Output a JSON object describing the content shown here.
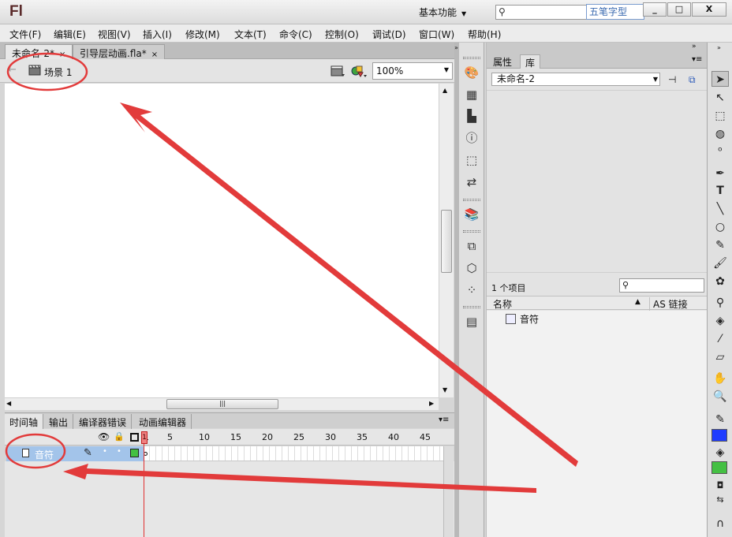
{
  "app": {
    "logo": "Fl",
    "workspace": "基本功能",
    "ime_badge": "五笔字型"
  },
  "window_buttons": [
    "_",
    "□",
    "X"
  ],
  "menu": [
    "文件(F)",
    "编辑(E)",
    "视图(V)",
    "插入(I)",
    "修改(M)",
    "文本(T)",
    "命令(C)",
    "控制(O)",
    "调试(D)",
    "窗口(W)",
    "帮助(H)"
  ],
  "doc_tabs": [
    {
      "label": "未命名-2*",
      "close": "×"
    },
    {
      "label": "引导层动画.fla*",
      "close": "×"
    }
  ],
  "editbar": {
    "scene": "场景 1",
    "zoom": "100%"
  },
  "timeline": {
    "tabs": [
      "时间轴",
      "输出",
      "编译器错误",
      "动画编辑器"
    ],
    "ruler": [
      "1",
      "5",
      "10",
      "15",
      "20",
      "25",
      "30",
      "35",
      "40",
      "45"
    ],
    "layer_name": "音符",
    "playhead_frame": "1"
  },
  "library": {
    "tabs": [
      "属性",
      "库"
    ],
    "active_tab": "库",
    "document": "未命名-2",
    "item_count": "1 个项目",
    "col_name": "名称",
    "col_linkage": "AS 链接",
    "items": [
      "音符"
    ]
  },
  "colors": {
    "stroke": "#1a1a1a",
    "fill_blue": "#1f3cff",
    "fill_green": "#44c043",
    "annotation": "#e23b3b",
    "layer_highlight": "#a3c4ea"
  },
  "icons": {
    "panel_column": [
      "color-icon",
      "swatches-icon",
      "align-icon",
      "info-icon",
      "transform-icon",
      "history-icon",
      "library-icon",
      "code-snippets-icon",
      "components-icon",
      "motion-presets-icon",
      "project-icon"
    ],
    "tools": [
      "selection-icon",
      "subselection-icon",
      "free-transform-icon",
      "3d-rotation-icon",
      "lasso-icon",
      "pen-icon",
      "text-icon",
      "line-icon",
      "oval-icon",
      "pencil-icon",
      "brush-icon",
      "deco-icon",
      "bone-icon",
      "paint-bucket-icon",
      "eyedropper-icon",
      "eraser-icon",
      "hand-icon",
      "zoom-icon"
    ]
  }
}
